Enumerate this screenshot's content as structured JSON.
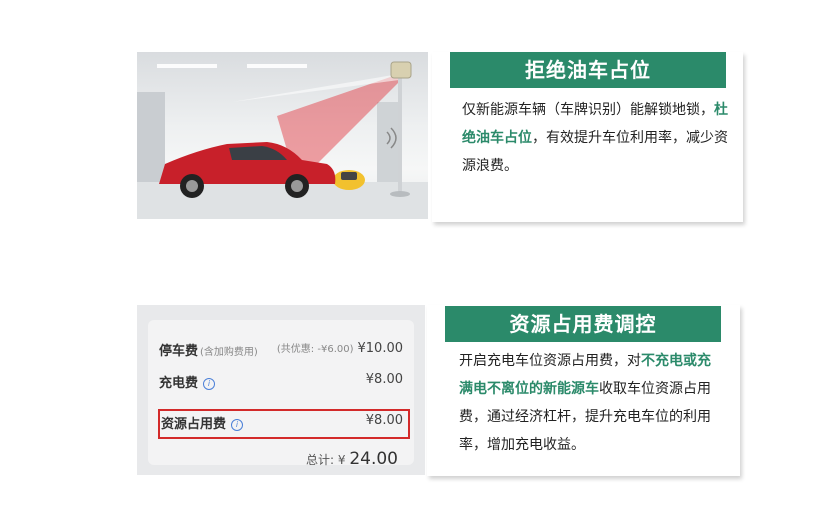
{
  "card1": {
    "title": "拒绝油车占位",
    "body": {
      "part1": "仅新能源车辆（车牌识别）能解锁地锁，",
      "highlight": "杜绝油车占位",
      "part2": "，有效提升车位利用率，减少资源浪费。"
    }
  },
  "card2": {
    "title": "资源占用费调控",
    "body": {
      "part1": "开启充电车位资源占用费，对",
      "highlight": "不充电或充满电不离位的新能源车",
      "part2": "收取车位资源占用费，通过经济杠杆，提升充电车位的利用率，增加充电收益。"
    },
    "receipt": {
      "rows": [
        {
          "label": "停车费",
          "note": "(含加购费用)",
          "discount": "(共优惠: -¥6.00)",
          "amount": "¥10.00"
        },
        {
          "label": "充电费",
          "amount": "¥8.00"
        },
        {
          "label": "资源占用费",
          "amount": "¥8.00"
        }
      ],
      "total_label": "总计:",
      "total_currency": "¥",
      "total_value": "24.00"
    }
  },
  "colors": {
    "accent": "#2b8a6a",
    "highlight_border": "#d32a2a",
    "car": "#c8202a"
  }
}
